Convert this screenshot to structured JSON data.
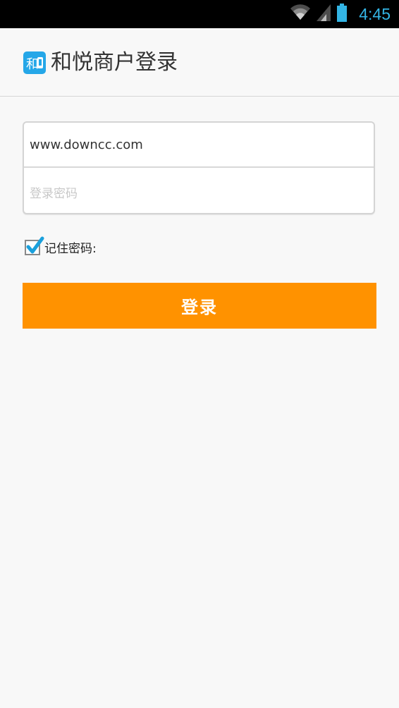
{
  "status_bar": {
    "time": "4:45",
    "icons": [
      "wifi-icon",
      "signal-icon",
      "battery-icon"
    ]
  },
  "app_bar": {
    "title": "和悦商户登录",
    "logo_icon": "app-logo-icon",
    "logo_text": "和"
  },
  "login_form": {
    "username_value": "www.downcc.com",
    "password_placeholder": "登录密码",
    "remember_label": "记住密码:",
    "remember_checked": true,
    "submit_label": "登录"
  },
  "colors": {
    "status_bar_bg": "#000000",
    "clock": "#33b5e5",
    "accent_orange": "#ff9200",
    "checkmark": "#1aa0dc",
    "logo_blue": "#25a7e8"
  }
}
